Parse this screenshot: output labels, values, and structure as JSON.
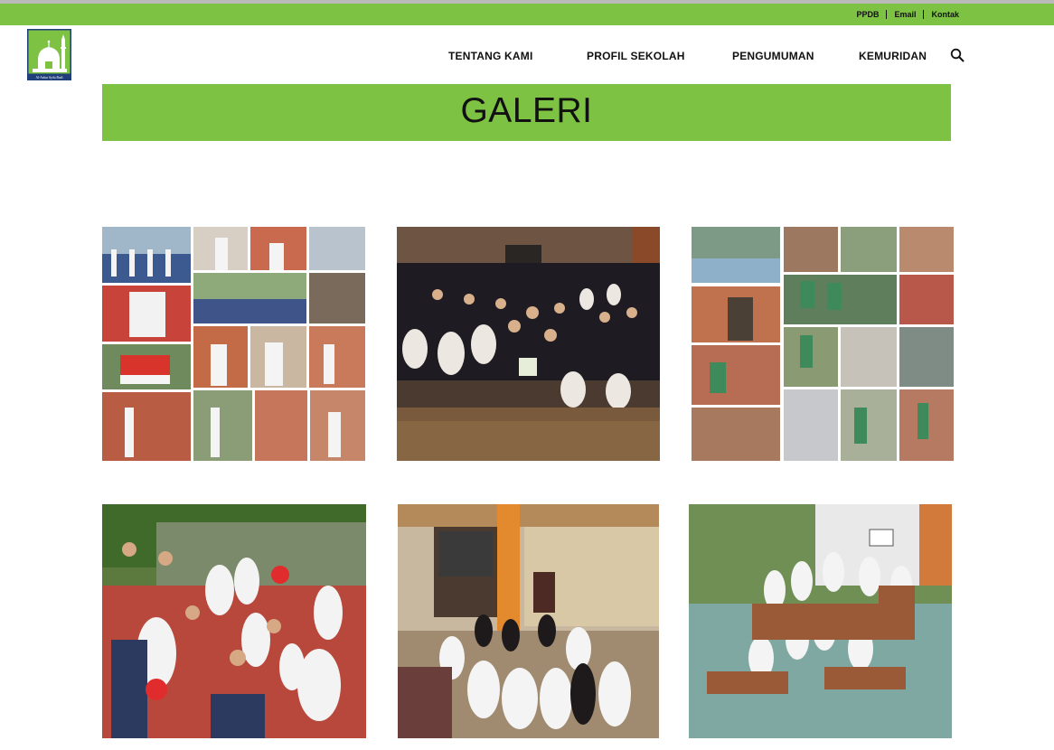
{
  "topbar": {
    "links": [
      "PPDB",
      "Email",
      "Kontak"
    ]
  },
  "logo": {
    "caption": "Al-Azhar Syifa Budi"
  },
  "nav": {
    "items": [
      "TENTANG KAMI",
      "PROFIL SEKOLAH",
      "PENGUMUMAN",
      "KEMURIDAN"
    ]
  },
  "icons": {
    "search": "search-icon",
    "logo": "mosque-logo-icon"
  },
  "colors": {
    "brand_green": "#7dc242",
    "top_strip": "#b9b9b9",
    "text": "#111111"
  },
  "banner": {
    "title": "GALERI"
  },
  "gallery": {
    "photos": [
      {
        "name": "flag-ceremony-collage"
      },
      {
        "name": "graduation-group-photo"
      },
      {
        "name": "charity-distribution-collage"
      },
      {
        "name": "students-outdoor-group-photo"
      },
      {
        "name": "students-indoor-group-photo"
      },
      {
        "name": "students-courtyard-group-photo"
      }
    ]
  }
}
